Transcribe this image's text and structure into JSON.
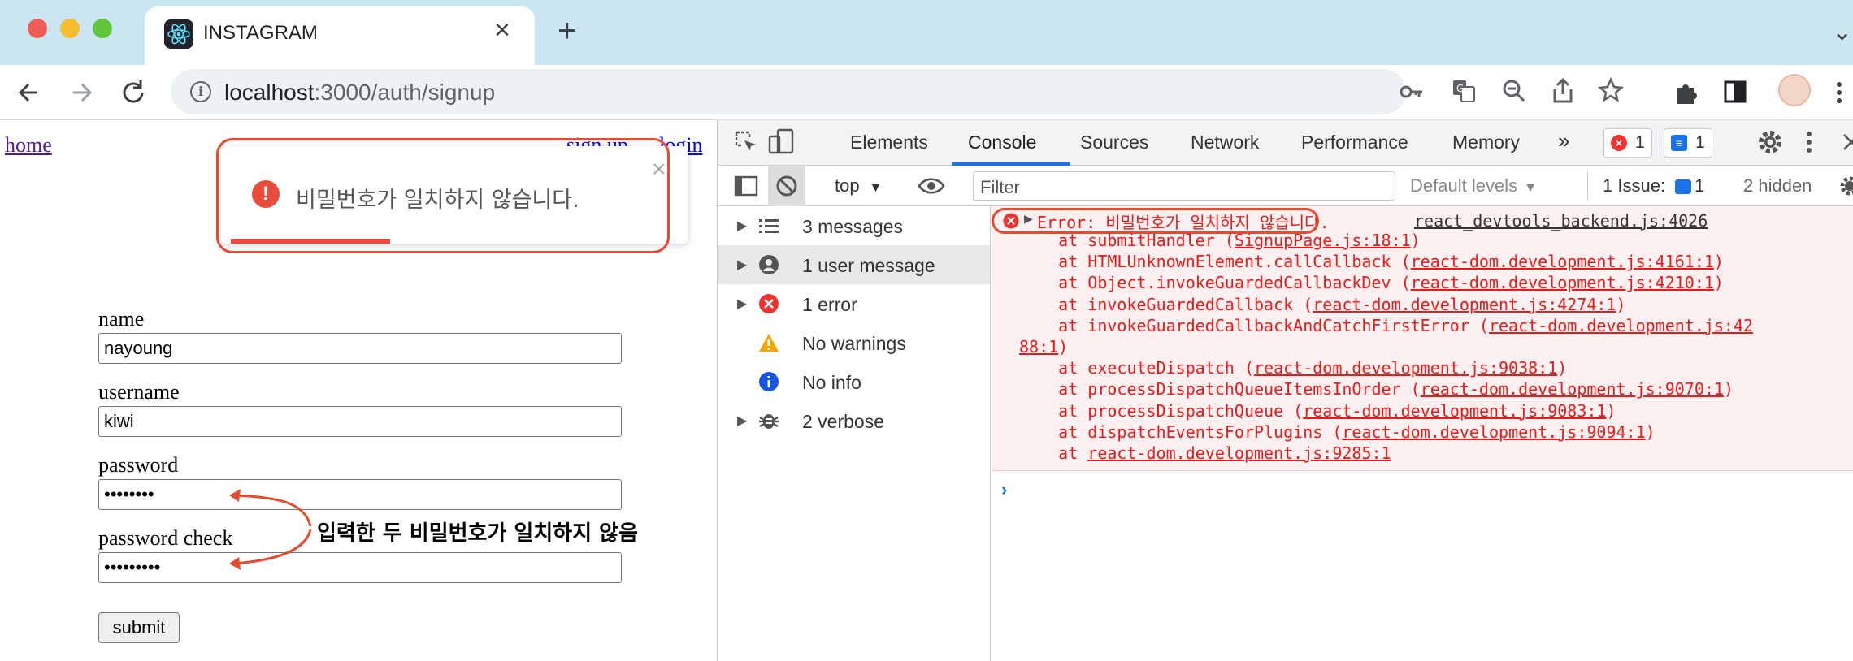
{
  "browser": {
    "tab": {
      "title": "INSTAGRAM",
      "close_glyph": "×"
    },
    "new_tab_glyph": "+",
    "tab_menu_glyph": "⌄",
    "address": {
      "host": "localhost",
      "port_path": ":3000/auth/signup"
    },
    "traffic_lights": [
      "#ee5d58",
      "#f7bd2f",
      "#5fc63d"
    ]
  },
  "page": {
    "nav": {
      "home": "home",
      "signup": "sign up",
      "login": "login"
    },
    "toast": {
      "message": "비밀번호가 일치하지 않습니다.",
      "close": "×",
      "icon": "!",
      "progress": 0.34
    },
    "form": {
      "fields": [
        {
          "label": "name",
          "value": "nayoung"
        },
        {
          "label": "username",
          "value": "kiwi"
        },
        {
          "label": "password",
          "value": "••••••••"
        },
        {
          "label": "password check",
          "value": "•••••••••"
        }
      ],
      "submit": "submit"
    },
    "annotation": "입력한 두 비밀번호가 일치하지 않음"
  },
  "devtools": {
    "tabs": [
      "Elements",
      "Console",
      "Sources",
      "Network",
      "Performance",
      "Memory",
      "»"
    ],
    "active_tab": "Console",
    "error_count": "1",
    "message_count": "1",
    "filterbar": {
      "context": "top",
      "filter_placeholder": "Filter",
      "levels": "Default levels",
      "issues_label": "1 Issue:",
      "issues_count": "1",
      "hidden": "2 hidden"
    },
    "sidebar": [
      {
        "label": "3 messages",
        "icon": "list-icon"
      },
      {
        "label": "1 user message",
        "icon": "user-icon"
      },
      {
        "label": "1 error",
        "icon": "error-icon"
      },
      {
        "label": "No warnings",
        "icon": "warning-icon"
      },
      {
        "label": "No info",
        "icon": "info-icon"
      },
      {
        "label": "2 verbose",
        "icon": "bug-icon"
      }
    ],
    "console": {
      "error_head": "Error: 비밀번호가 일치하지 않습니다.",
      "source": "react_devtools_backend.js:4026",
      "stack": [
        {
          "pre": "    at submitHandler (",
          "link": "SignupPage.js:18:1",
          "post": ")"
        },
        {
          "pre": "    at HTMLUnknownElement.callCallback (",
          "link": "react-dom.development.js:4161:1",
          "post": ")"
        },
        {
          "pre": "    at Object.invokeGuardedCallbackDev (",
          "link": "react-dom.development.js:4210:1",
          "post": ")"
        },
        {
          "pre": "    at invokeGuardedCallback (",
          "link": "react-dom.development.js:4274:1",
          "post": ")"
        },
        {
          "pre": "    at invokeGuardedCallbackAndCatchFirstError (",
          "link": "react-dom.development.js:42",
          "post": ""
        },
        {
          "pre": "",
          "link": "88:1",
          "post": ")"
        },
        {
          "pre": "    at executeDispatch (",
          "link": "react-dom.development.js:9038:1",
          "post": ")"
        },
        {
          "pre": "    at processDispatchQueueItemsInOrder (",
          "link": "react-dom.development.js:9070:1",
          "post": ")"
        },
        {
          "pre": "    at processDispatchQueue (",
          "link": "react-dom.development.js:9083:1",
          "post": ")"
        },
        {
          "pre": "    at dispatchEventsForPlugins (",
          "link": "react-dom.development.js:9094:1",
          "post": ")"
        },
        {
          "pre": "    at ",
          "link": "react-dom.development.js:9285:1",
          "post": ""
        }
      ],
      "prompt": "›"
    }
  }
}
